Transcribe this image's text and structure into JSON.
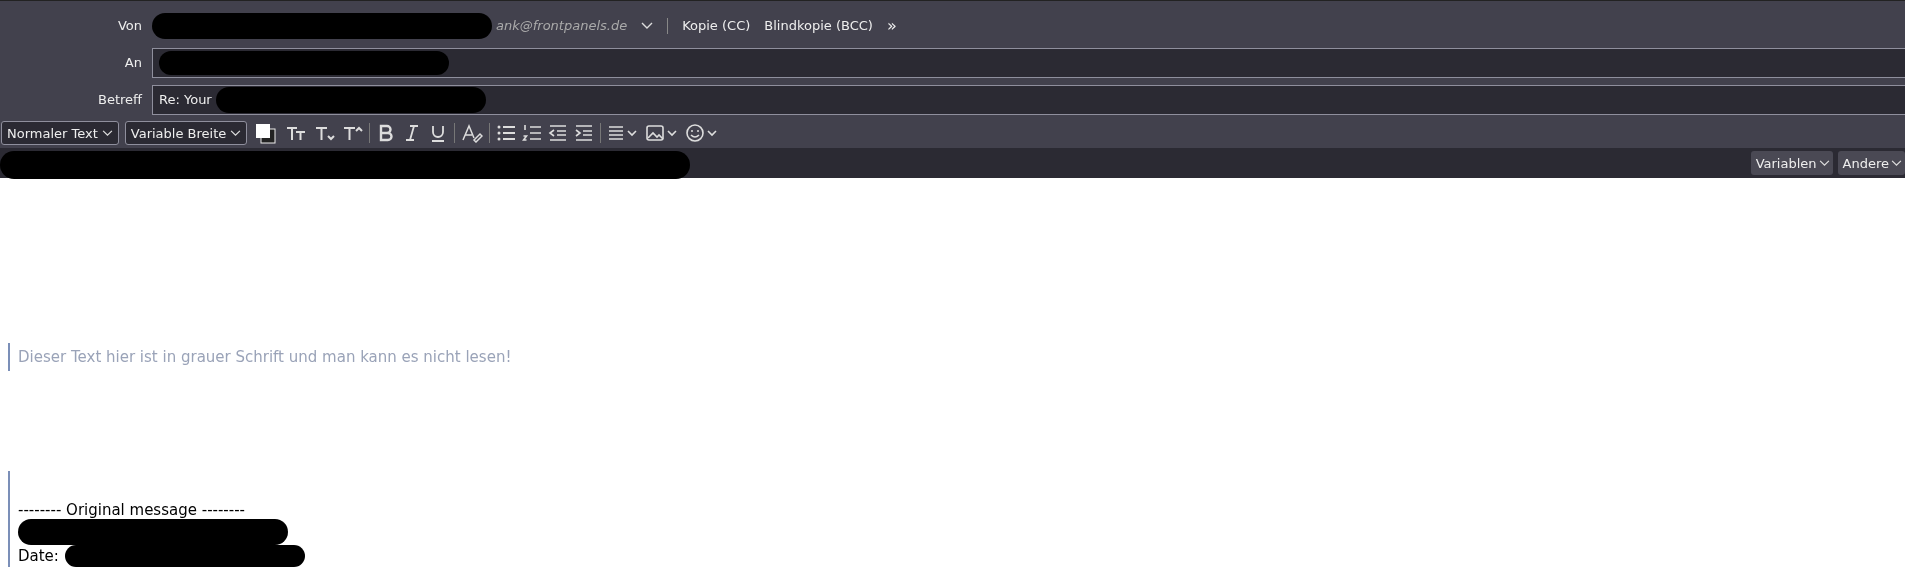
{
  "header": {
    "from": {
      "label": "Von",
      "address_tail": "ank@frontpanels.de",
      "links": [
        "Kopie (CC)",
        "Blindkopie (BCC)"
      ],
      "more": "»"
    },
    "to": {
      "label": "An"
    },
    "subject": {
      "label": "Betreff",
      "value": "Re: Your"
    }
  },
  "format_toolbar": {
    "paragraph": "Normaler Text",
    "font": "Variable Breite"
  },
  "attachment_bar": {
    "buttons": [
      "Variablen",
      "Andere"
    ]
  },
  "body": {
    "faint_line": "Dieser Text hier ist in grauer Schrift und man kann es nicht lesen!",
    "separator": "-------- Original message --------",
    "date_label": "Date:"
  }
}
